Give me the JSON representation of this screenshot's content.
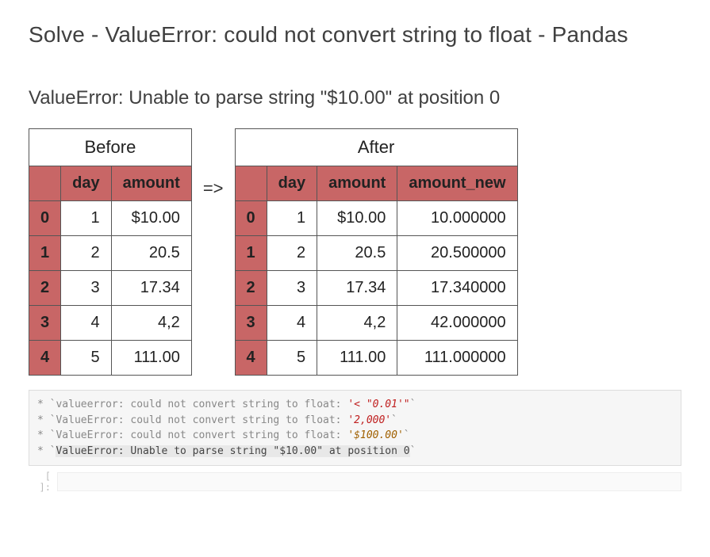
{
  "title": "Solve - ValueError: could not convert string to float - Pandas",
  "subtitle": "ValueError: Unable to parse string \"$10.00\" at position 0",
  "arrow": "=>",
  "before": {
    "label": "Before",
    "columns": [
      "day",
      "amount"
    ],
    "rows": [
      {
        "idx": "0",
        "day": "1",
        "amount": "$10.00"
      },
      {
        "idx": "1",
        "day": "2",
        "amount": "20.5"
      },
      {
        "idx": "2",
        "day": "3",
        "amount": "17.34"
      },
      {
        "idx": "3",
        "day": "4",
        "amount": "4,2"
      },
      {
        "idx": "4",
        "day": "5",
        "amount": "111.00"
      }
    ]
  },
  "after": {
    "label": "After",
    "columns": [
      "day",
      "amount",
      "amount_new"
    ],
    "rows": [
      {
        "idx": "0",
        "day": "1",
        "amount": "$10.00",
        "amount_new": "10.000000"
      },
      {
        "idx": "1",
        "day": "2",
        "amount": "20.5",
        "amount_new": "20.500000"
      },
      {
        "idx": "2",
        "day": "3",
        "amount": "17.34",
        "amount_new": "17.340000"
      },
      {
        "idx": "3",
        "day": "4",
        "amount": "4,2",
        "amount_new": "42.000000"
      },
      {
        "idx": "4",
        "day": "5",
        "amount": "111.00",
        "amount_new": "111.000000"
      }
    ]
  },
  "errors": {
    "line1_a": "* `valueerror: could not convert string to float: ",
    "line1_b": "'< \"0.01'\"",
    "line1_c": "`",
    "line2_a": "* `ValueError: could not convert string to float: ",
    "line2_b": "'2,000'",
    "line2_c": "`",
    "line3_a": "* `ValueError: could not convert string to float: ",
    "line3_b": "'$100.00'",
    "line3_c": "`",
    "line4_a": "* `",
    "line4_b": "ValueError: Unable to parse string \"$10.00\" at position 0",
    "line4_c": "`"
  },
  "prompt_label": "[ ]:"
}
